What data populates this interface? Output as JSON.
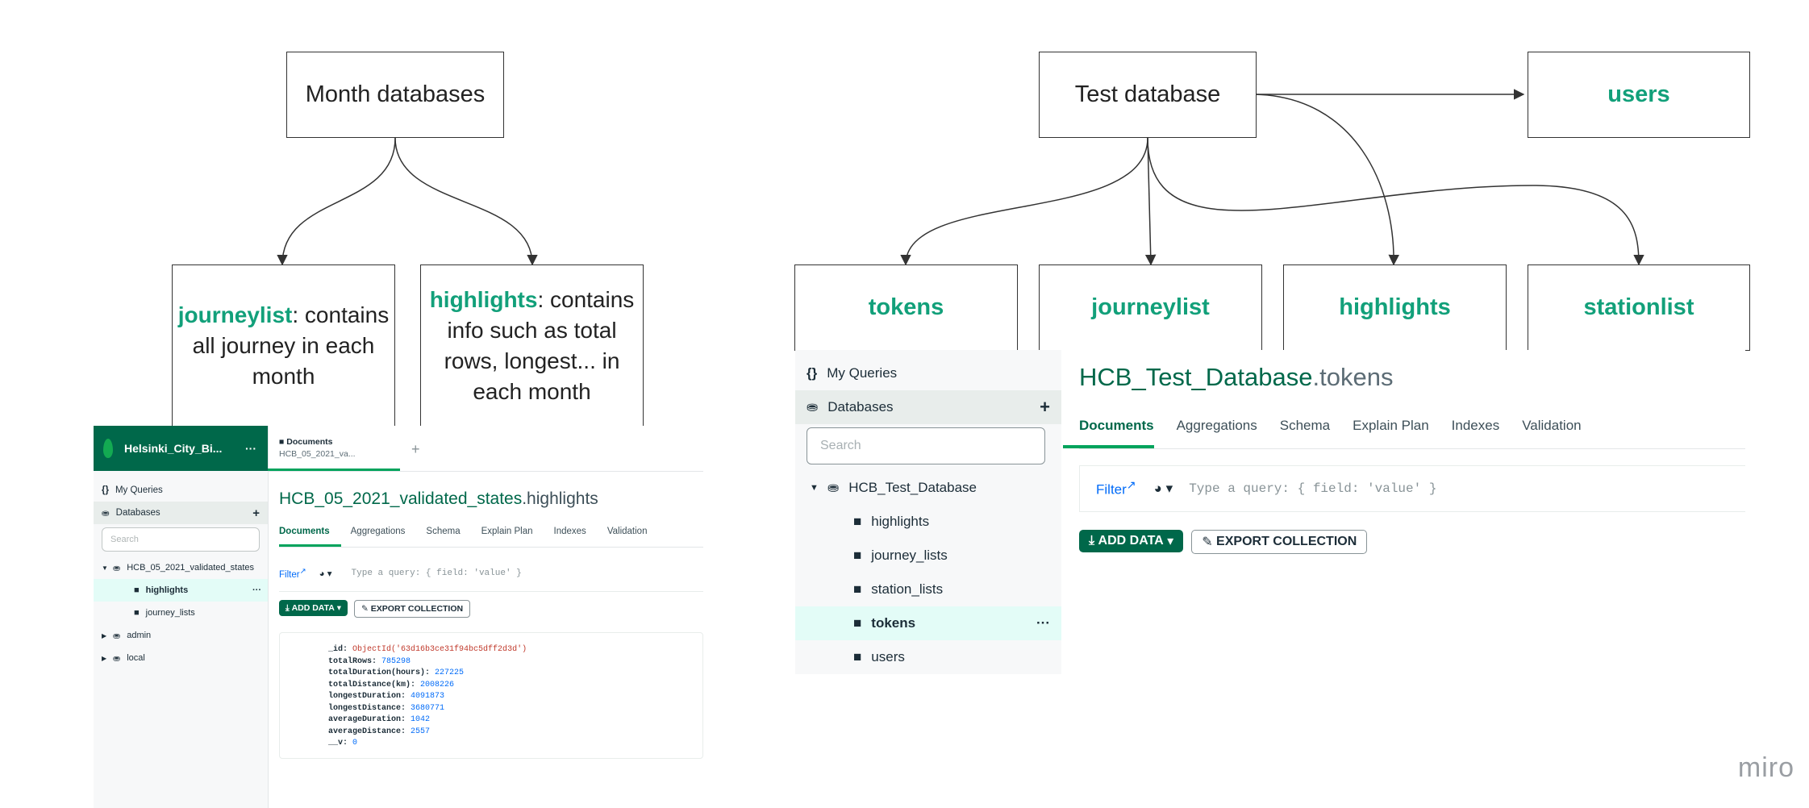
{
  "diagram": {
    "left": {
      "root": "Month databases",
      "children": [
        {
          "name": "journeylist",
          "text": ": contains all journey in each month"
        },
        {
          "name": "highlights",
          "text": ": contains info such as total rows, longest... in each month"
        }
      ]
    },
    "right": {
      "root": "Test database",
      "children": [
        "users",
        "tokens",
        "journeylist",
        "highlights",
        "stationlist"
      ]
    }
  },
  "screenshot_small": {
    "connection": "Helsinki_City_Bi...",
    "conn_menu": "···",
    "my_queries": "My Queries",
    "databases": "Databases",
    "search_placeholder": "Search",
    "db_name": "HCB_05_2021_validated_states",
    "collections": [
      "highlights",
      "journey_lists"
    ],
    "other_dbs": [
      "admin",
      "local"
    ],
    "active_tab_title": "Documents",
    "active_tab_sub": "HCB_05_2021_va...",
    "namespace_db": "HCB_05_2021_validated_states",
    "namespace_coll": ".highlights",
    "tabs": [
      "Documents",
      "Aggregations",
      "Schema",
      "Explain Plan",
      "Indexes",
      "Validation"
    ],
    "filter_label": "Filter",
    "query_placeholder": "Type a query: { field: 'value' }",
    "add_data": "ADD DATA",
    "export": "EXPORT COLLECTION",
    "document": [
      {
        "key": "_id:",
        "value": "ObjectId('63d16b3ce31f94bc5dff2d3d')"
      },
      {
        "key": "totalRows:",
        "value": "785298"
      },
      {
        "key": "totalDuration(hours):",
        "value": "227225"
      },
      {
        "key": "totalDistance(km):",
        "value": "2008226"
      },
      {
        "key": "longestDuration:",
        "value": "4091873"
      },
      {
        "key": "longestDistance:",
        "value": "3680771"
      },
      {
        "key": "averageDuration:",
        "value": "1042"
      },
      {
        "key": "averageDistance:",
        "value": "2557"
      },
      {
        "key": "__v:",
        "value": "0"
      }
    ]
  },
  "screenshot_large": {
    "my_queries": "My Queries",
    "databases": "Databases",
    "search_placeholder": "Search",
    "db_name": "HCB_Test_Database",
    "collections": [
      "highlights",
      "journey_lists",
      "station_lists",
      "tokens",
      "users"
    ],
    "active_collection": "tokens",
    "namespace_db": "HCB_Test_Database",
    "namespace_coll": ".tokens",
    "tabs": [
      "Documents",
      "Aggregations",
      "Schema",
      "Explain Plan",
      "Indexes",
      "Validation"
    ],
    "filter_label": "Filter",
    "query_placeholder": "Type a query: { field: 'value' }",
    "add_data": "ADD DATA",
    "export": "EXPORT COLLECTION",
    "row_menu": "···"
  },
  "watermark": "miro",
  "colors": {
    "accent_green": "#12a07a",
    "compass_green": "#00684a",
    "link_blue": "#016bf8"
  }
}
